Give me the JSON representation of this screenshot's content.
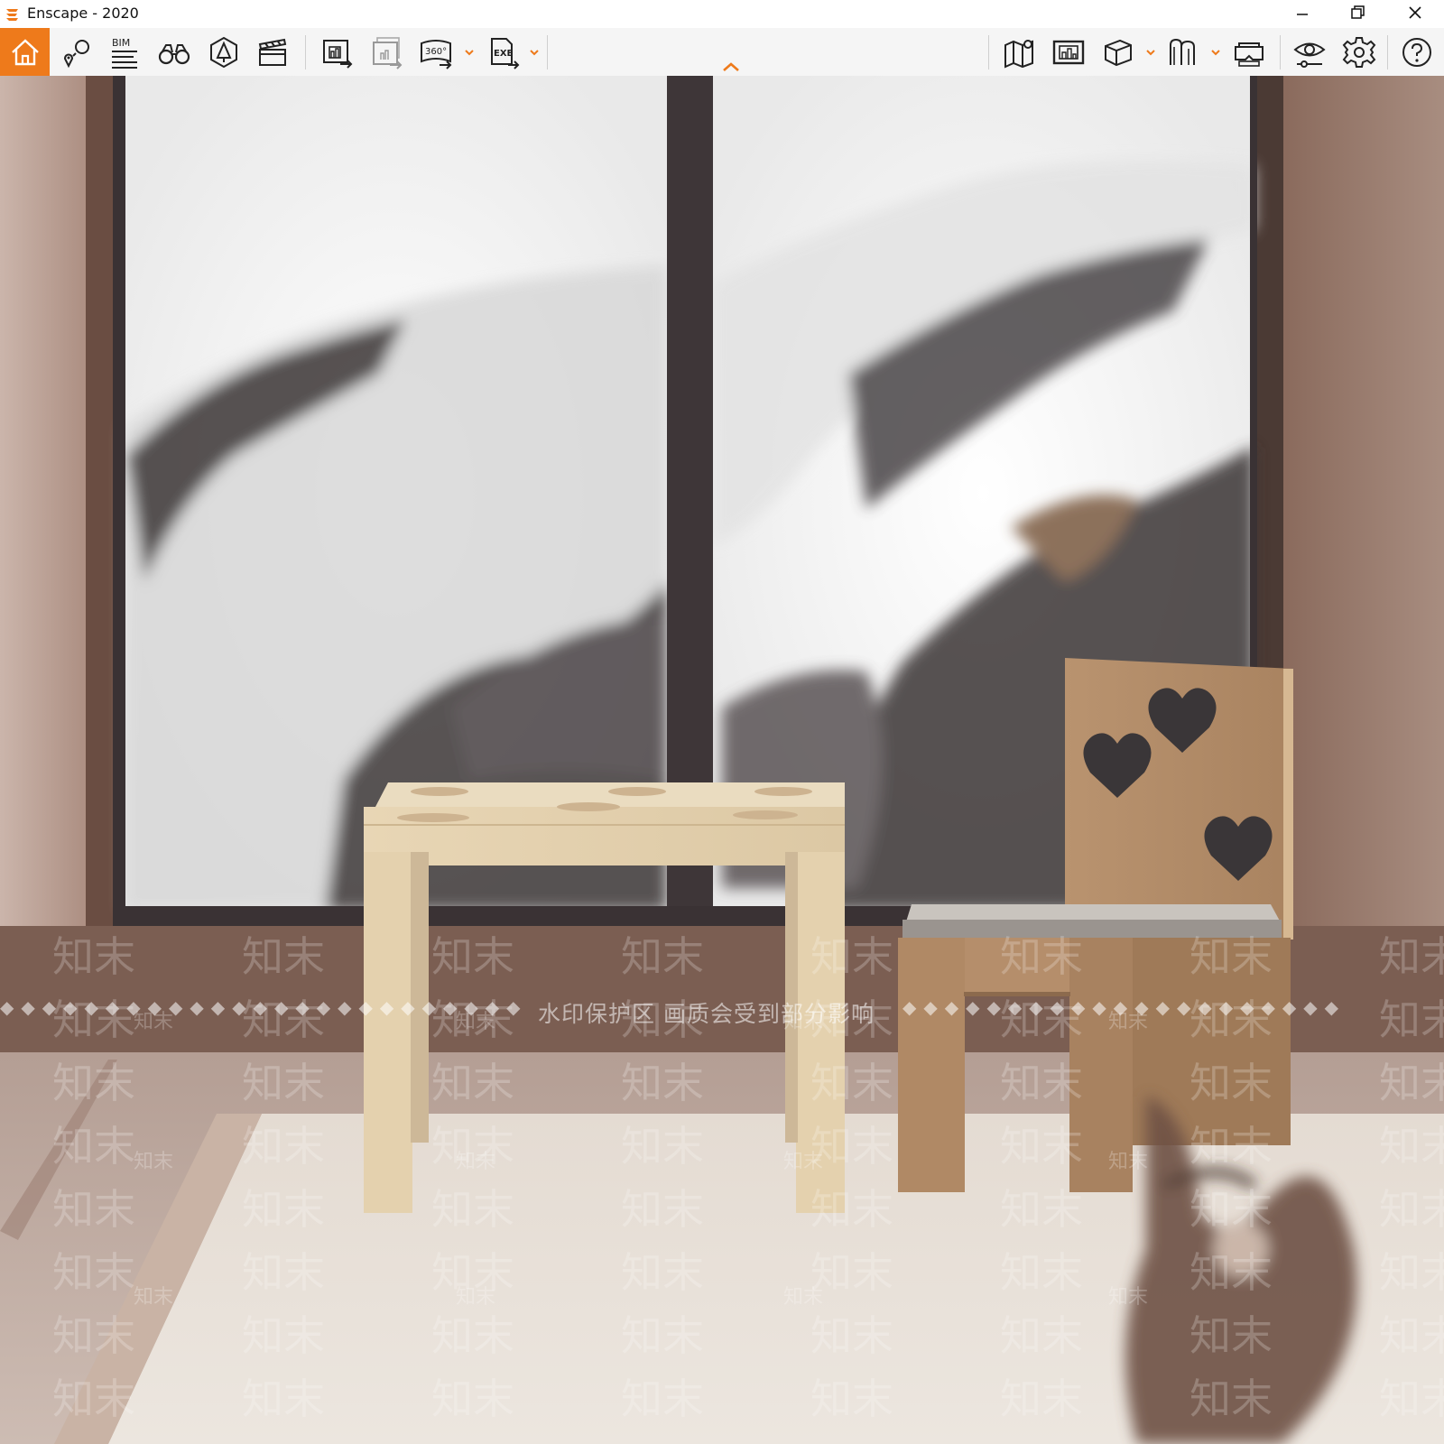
{
  "window": {
    "title": "Enscape - 2020",
    "controls": [
      "minimize-icon",
      "restore-icon",
      "close-icon"
    ]
  },
  "colors": {
    "accent": "#ee7a1b",
    "toolbar_bg": "#f5f5f5",
    "icon_stroke": "#222222"
  },
  "toolbar": {
    "left_tools": [
      "home-icon",
      "bookmark-views-icon",
      "bim-icon",
      "binoculars-icon",
      "asset-library-icon",
      "video-editor-icon",
      "render-screenshot-icon",
      "batch-render-icon",
      "panorama-360-icon",
      "export-exe-icon"
    ],
    "bim_label": "BIM",
    "panorama_label": "360°",
    "exe_label": "EXE",
    "right_tools": [
      "map-icon",
      "render-gallery-icon",
      "object-cube-icon",
      "material-editor-icon",
      "vr-headset-icon",
      "visual-settings-icon",
      "settings-gear-icon",
      "help-icon"
    ]
  },
  "viewport": {
    "watermark_notice": "水印保护区   画质会受到部分影响",
    "watermark_text": "知末"
  }
}
